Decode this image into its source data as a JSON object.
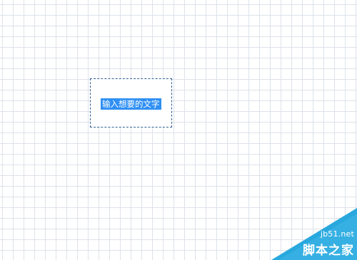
{
  "canvas": {
    "grid_color": "#dde2ea",
    "background_color": "#ffffff"
  },
  "textbox": {
    "text": "输入想要的文字",
    "selection_color": "#2f8ff4",
    "border_color": "#2f5f95"
  },
  "watermark": {
    "site": "jb51.net",
    "name": "脚本之家",
    "color": "#29a8de"
  }
}
